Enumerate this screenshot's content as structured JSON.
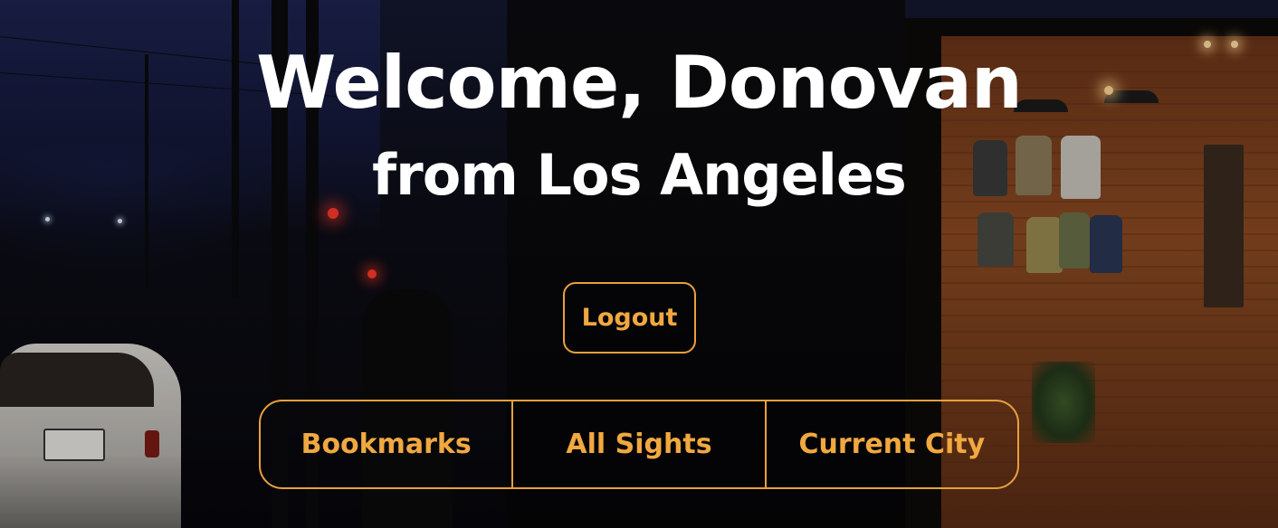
{
  "hero": {
    "title": "Welcome, Donovan",
    "subtitle": "from Los Angeles"
  },
  "actions": {
    "logout_label": "Logout"
  },
  "nav": {
    "items": [
      {
        "label": "Bookmarks"
      },
      {
        "label": "All Sights"
      },
      {
        "label": "Current City"
      }
    ]
  },
  "colors": {
    "accent": "#e8a03c",
    "heading": "#ffffff"
  }
}
